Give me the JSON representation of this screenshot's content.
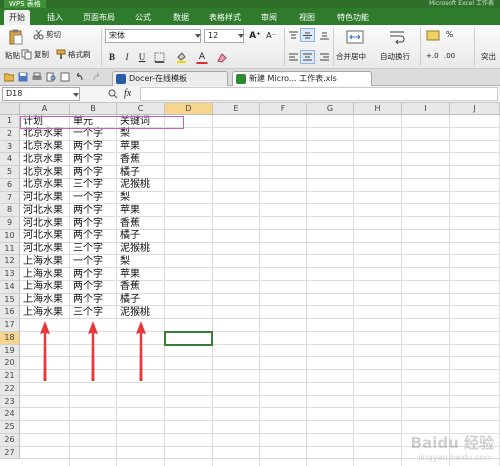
{
  "app": {
    "name": "WPS 表格",
    "title_right": "Microsoft Excel 工作表"
  },
  "ribbon_tabs": [
    "开始",
    "插入",
    "页面布局",
    "公式",
    "数据",
    "表格样式",
    "审阅",
    "视图",
    "特色功能"
  ],
  "ribbon": {
    "cut": "剪切",
    "copy": "复制",
    "paste": "粘贴",
    "format_painter": "格式刷",
    "font_name": "宋体",
    "font_size": "12",
    "merge_center": "合并居中",
    "wrap_text": "自动换行",
    "number_format": "%",
    "bold": "B",
    "italic": "I",
    "underline": "U",
    "font_color_glyph": "A",
    "grow_font": "A⁺",
    "shrink_font": "A⁻",
    "highlight": "突出"
  },
  "doc_tabs": [
    {
      "label": "Docer-在线模板",
      "active": false
    },
    {
      "label": "新建 Micro... 工作表.xls",
      "active": true
    }
  ],
  "formula_bar": {
    "cell_ref": "D18",
    "fx": "fx",
    "value": ""
  },
  "columns": [
    "A",
    "B",
    "C",
    "D",
    "E",
    "F",
    "G",
    "H",
    "I",
    "J"
  ],
  "selected_column": "D",
  "selected_row": 18,
  "rows": [
    1,
    2,
    3,
    4,
    5,
    6,
    7,
    8,
    9,
    10,
    11,
    12,
    13,
    14,
    15,
    16,
    17,
    18,
    19,
    20,
    21,
    22,
    23,
    24,
    25,
    26,
    27
  ],
  "sheet": [
    [
      "计划",
      "单元",
      "关键词"
    ],
    [
      "北京水果",
      "一个字",
      "梨"
    ],
    [
      "北京水果",
      "两个字",
      "苹果"
    ],
    [
      "北京水果",
      "两个字",
      "香蕉"
    ],
    [
      "北京水果",
      "两个字",
      "橘子"
    ],
    [
      "北京水果",
      "三个字",
      "泥猴桃"
    ],
    [
      "河北水果",
      "一个字",
      "梨"
    ],
    [
      "河北水果",
      "两个字",
      "苹果"
    ],
    [
      "河北水果",
      "两个字",
      "香蕉"
    ],
    [
      "河北水果",
      "两个字",
      "橘子"
    ],
    [
      "河北水果",
      "三个字",
      "泥猴桃"
    ],
    [
      "上海水果",
      "一个字",
      "梨"
    ],
    [
      "上海水果",
      "两个字",
      "苹果"
    ],
    [
      "上海水果",
      "两个字",
      "香蕉"
    ],
    [
      "上海水果",
      "两个字",
      "橘子"
    ],
    [
      "上海水果",
      "三个字",
      "泥猴桃"
    ]
  ],
  "colors": {
    "arrow": "#e8383d",
    "accent": "#2f7b2c",
    "highlight_border": "#c060c0",
    "active_cell": "#3a7f34"
  },
  "watermark": {
    "text": "Baidu 经验",
    "sub": "jingyan.baidu.com"
  }
}
